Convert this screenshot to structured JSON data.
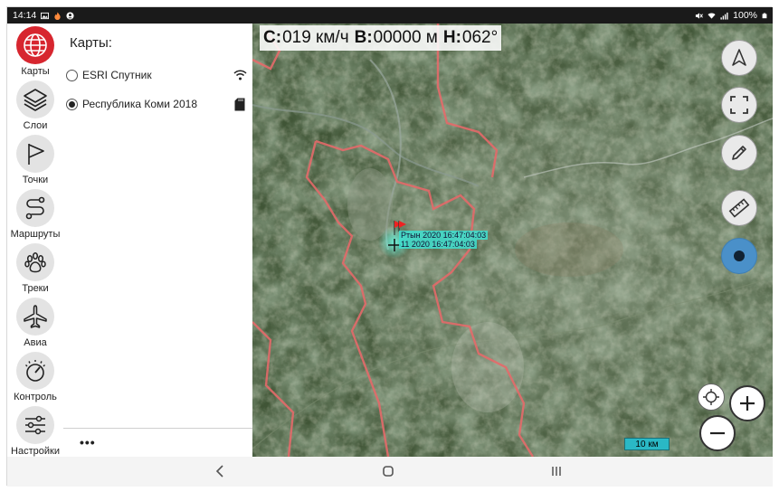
{
  "status_bar": {
    "time": "14:14",
    "battery": "100%",
    "left_icons": [
      "image-icon",
      "fire-icon",
      "account-icon"
    ],
    "right_icons": [
      "mute-icon",
      "wifi-icon",
      "signal-icon",
      "battery-icon"
    ]
  },
  "sidebar": {
    "items": [
      {
        "label": "Карты",
        "icon": "globe-icon",
        "active": true
      },
      {
        "label": "Слои",
        "icon": "layers-icon",
        "active": false
      },
      {
        "label": "Точки",
        "icon": "flag-icon",
        "active": false
      },
      {
        "label": "Маршруты",
        "icon": "route-icon",
        "active": false
      },
      {
        "label": "Треки",
        "icon": "paw-icon",
        "active": false
      },
      {
        "label": "Авиа",
        "icon": "airplane-icon",
        "active": false
      },
      {
        "label": "Контроль",
        "icon": "gauge-icon",
        "active": false
      },
      {
        "label": "Настройки",
        "icon": "sliders-icon",
        "active": false
      }
    ],
    "active_color": "#d7262f"
  },
  "maps_panel": {
    "title": "Карты:",
    "layers": [
      {
        "label": "ESRI Спутник",
        "selected": false,
        "icon": "wifi-icon"
      },
      {
        "label": "Республика Коми 2018",
        "selected": true,
        "icon": "sd-card-icon"
      }
    ],
    "more_label": "•••"
  },
  "hud": {
    "speed_key": "С:",
    "speed_value": "019 км/ч",
    "altitude_key": "В:",
    "altitude_value": "00000 м",
    "heading_key": "Н:",
    "heading_value": "062°"
  },
  "map": {
    "marker_label_1": "Ртын 2020 16:47:04:03",
    "marker_label_2": "11 2020 16:47:04:03",
    "scale_label": "10 км",
    "border_color": "#e46a6a",
    "controls": [
      "navigate-arrow-icon",
      "fullscreen-icon",
      "pencil-icon",
      "ruler-icon",
      "record-icon",
      "locate-icon",
      "zoom-in-icon",
      "zoom-out-icon"
    ]
  },
  "nav_bar": {
    "back": "<",
    "home": "◯",
    "recents": "|||"
  }
}
